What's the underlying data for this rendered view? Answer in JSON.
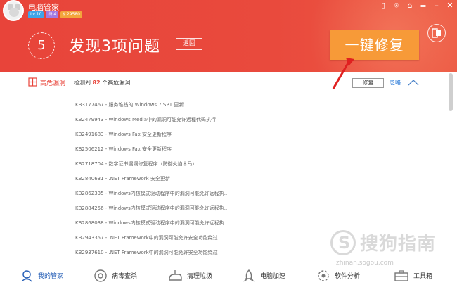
{
  "app": {
    "title": "电脑管家",
    "badges": [
      "Lv 10",
      "特 4",
      "$ 29580"
    ]
  },
  "window_controls": [
    "▯",
    "⍟",
    "⌂",
    "≡",
    "–",
    "✕"
  ],
  "header": {
    "issue_count": "5",
    "headline": "发现3项问题",
    "back_label": "返回",
    "fix_all_label": "一键修复"
  },
  "section": {
    "title": "高危漏洞",
    "subtitle_prefix": "检测到",
    "subtitle_count": "82",
    "subtitle_suffix": "个高危漏洞",
    "repair_label": "修复",
    "ignore_label": "忽略"
  },
  "vulnerabilities": [
    "KB3177467 - 服务堆栈的 Windows 7 SP1 更新",
    "KB2479943 - Windows Media中的漏洞可能允许远程代码执行",
    "KB2491683 - Windows Fax 安全更新程序",
    "KB2506212 - Windows Fax 安全更新程序",
    "KB2718704 - 数字证书漏洞修复程序（防御火焰木马）",
    "KB2840631 - .NET Framework 安全更新",
    "KB2862335 - Windows内核模式驱动程序中的漏洞可能允许远程执...",
    "KB2884256 - Windows内核模式驱动程序中的漏洞可能允许远程执...",
    "KB2868038 - Windows内核模式驱动程序中的漏洞可能允许远程执...",
    "KB2943357 - .NET Framework中的漏洞可能允许安全功能绕过",
    "KB2937610 - .NET Framework中的漏洞可能允许安全功能绕过"
  ],
  "nav": [
    {
      "label": "我的管家",
      "icon": "house-keeper-icon"
    },
    {
      "label": "病毒查杀",
      "icon": "virus-scan-icon"
    },
    {
      "label": "清理垃圾",
      "icon": "cleanup-icon"
    },
    {
      "label": "电脑加速",
      "icon": "rocket-icon"
    },
    {
      "label": "软件分析",
      "icon": "software-analysis-icon"
    },
    {
      "label": "工具箱",
      "icon": "toolbox-icon"
    }
  ],
  "watermark": {
    "text": "搜狗指南",
    "url": "zhinan.sogou.com"
  },
  "colors": {
    "header_red": "#e8443a",
    "fix_orange": "#f79a38",
    "link_blue": "#2a7ad8",
    "active_nav": "#2a62b8"
  }
}
